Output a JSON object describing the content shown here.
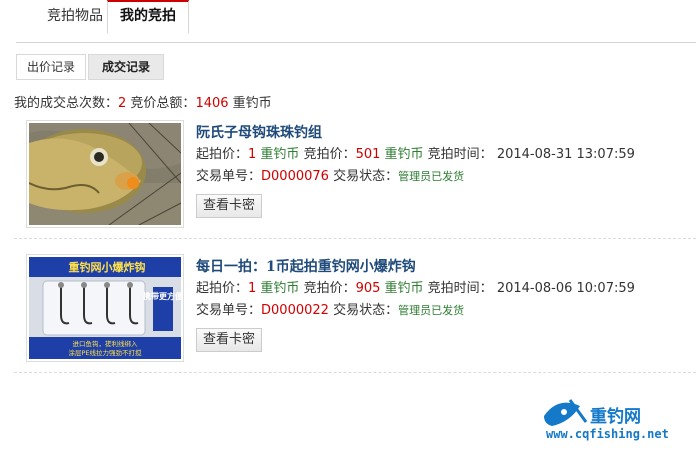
{
  "tabs": [
    {
      "label": "竞拍物品"
    },
    {
      "label": "我的竞拍"
    }
  ],
  "subtabs": [
    {
      "label": "出价记录"
    },
    {
      "label": "成交记录"
    }
  ],
  "summary": {
    "count_label": "我的成交总次数：",
    "count": "2",
    "total_label": " 竞价总额：",
    "total": "1406",
    "unit": " 重钓币"
  },
  "common": {
    "start_price_label": "起拍价：",
    "bid_price_label": " 竞拍价：",
    "time_label": " 竞拍时间：",
    "order_label": "交易单号：",
    "status_label": " 交易状态：",
    "currency": " 重钓币",
    "view_button": "查看卡密"
  },
  "items": [
    {
      "title": "阮氏子母钩珠珠钓组",
      "start_price": "1",
      "bid_price": "501",
      "time": "2014-08-31 13:07:59",
      "order": "D0000076",
      "status": "管理员已发货"
    },
    {
      "title": "每日一拍：1币起拍重钓网小爆炸钩",
      "start_price": "1",
      "bid_price": "905",
      "time": "2014-08-06 10:07:59",
      "order": "D0000022",
      "status": "管理员已发货",
      "image_text": {
        "header": "重钓网小爆炸钩",
        "side": "携带更方便",
        "footer1": "进口鱼钩，搓利线绑入",
        "footer2": "涂层PE线拉力强劲不打搅"
      }
    }
  ],
  "logo": {
    "name": "重钓网",
    "url": "www.cqfishing.net"
  },
  "colors": {
    "accent_red": "#d40000",
    "status_green": "#2e7d32",
    "title_blue": "#1f4a7a",
    "logo_blue": "#1479c9"
  }
}
